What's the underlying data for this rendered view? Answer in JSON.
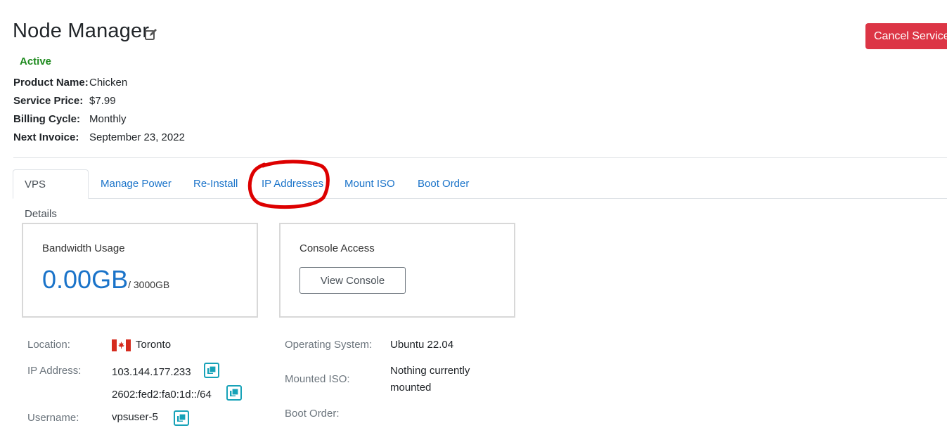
{
  "header": {
    "title": "Node Manager",
    "edit_icon": "pencil-square-icon",
    "cancel_label": "Cancel Service"
  },
  "status": "Active",
  "info": {
    "product_label": "Product Name:",
    "product_value": "Chicken",
    "price_label": "Service Price:",
    "price_value": "$7.99",
    "cycle_label": "Billing Cycle:",
    "cycle_value": "Monthly",
    "invoice_label": "Next Invoice:",
    "invoice_value": "September 23, 2022"
  },
  "tabs": [
    {
      "label": "VPS Details",
      "active": true
    },
    {
      "label": "Manage Power"
    },
    {
      "label": "Re-Install"
    },
    {
      "label": "IP Addresses",
      "highlighted": true
    },
    {
      "label": "Mount ISO"
    },
    {
      "label": "Boot Order"
    }
  ],
  "bandwidth": {
    "title": "Bandwidth Usage",
    "used": "0.00GB",
    "total": "/ 3000GB"
  },
  "console": {
    "title": "Console Access",
    "button_label": "View Console"
  },
  "details": {
    "location_label": "Location:",
    "location_value": "Toronto",
    "location_flag": "canada-flag-icon",
    "ip_label": "IP Address:",
    "ipv4": "103.144.177.233",
    "ipv6": "2602:fed2:fa0:1d::/64",
    "username_label": "Username:",
    "username_value": "vpsuser-5",
    "os_label": "Operating System:",
    "os_value": "Ubuntu 22.04",
    "iso_label": "Mounted ISO:",
    "iso_value_line1": "Nothing currently",
    "iso_value_line2": "mounted",
    "boot_label": "Boot Order:"
  },
  "colors": {
    "accent": "#1a73c9",
    "danger": "#dc3545",
    "success": "#1e8a1e",
    "copy": "#17a2b8",
    "annotation": "#dd0000"
  }
}
